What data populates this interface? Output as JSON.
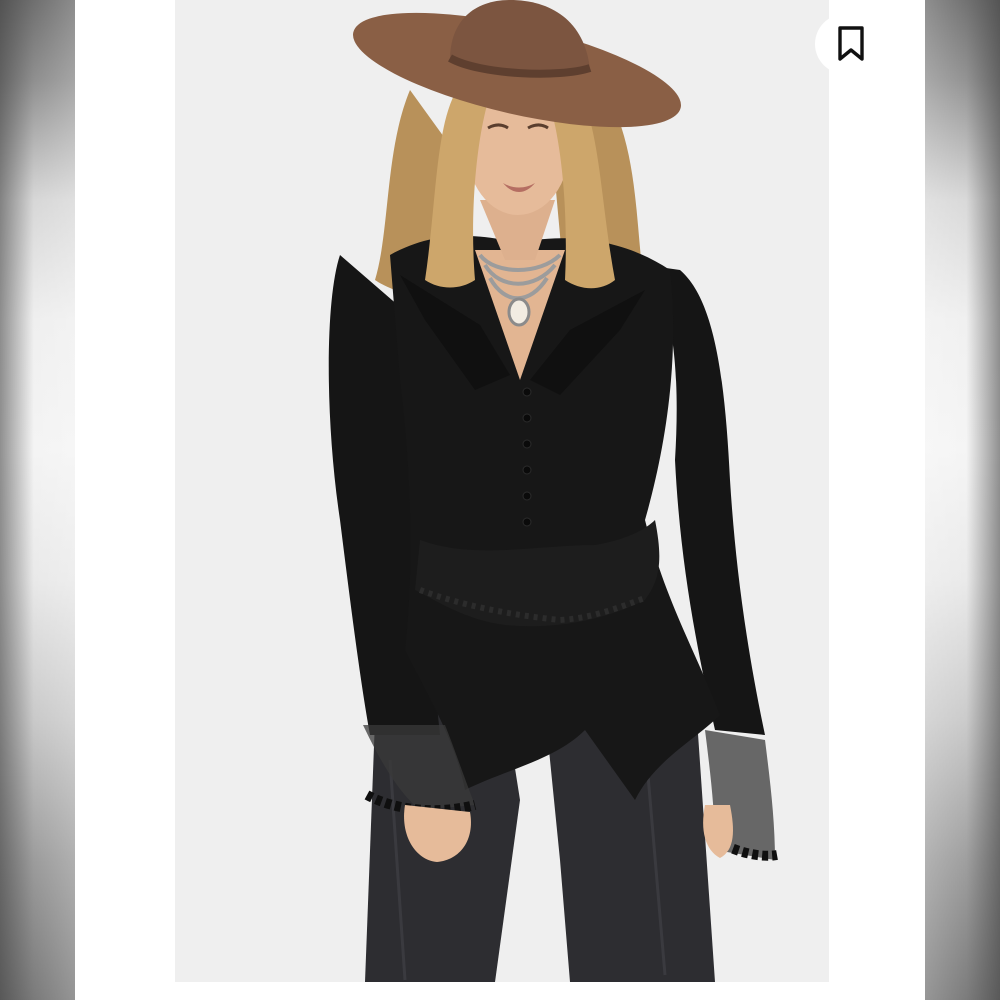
{
  "viewer": {
    "image_subject": "product-photo",
    "bookmark": {
      "icon": "bookmark-icon",
      "state": "not-saved"
    }
  },
  "colors": {
    "background": "#ffffff",
    "photo_backdrop": "#efefef",
    "garment": "#141414",
    "hat": "#8a5f45",
    "hair": "#c9a46a",
    "skin": "#e4b896",
    "jeans": "#2b2b2e",
    "bookmark_icon": "#111111"
  }
}
